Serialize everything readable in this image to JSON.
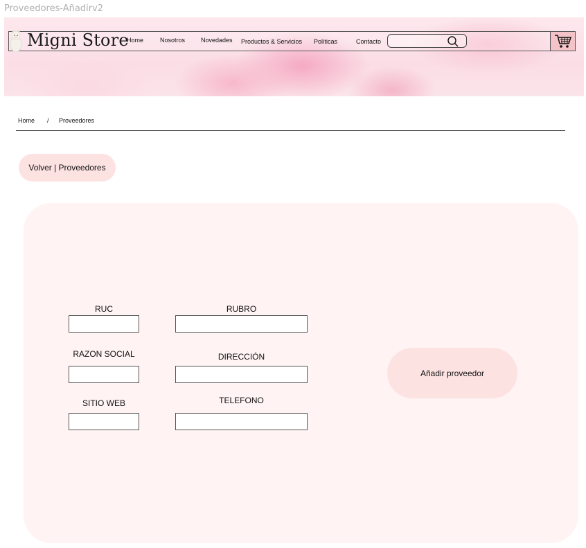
{
  "frame": {
    "title": "Proveedores-Añadirv2"
  },
  "header": {
    "brand": "Migni Store",
    "nav": [
      "Home",
      "Nosotros",
      "Novedades",
      "Productos & Servicios",
      "Políticas",
      "Contacto"
    ],
    "search": {
      "value": "",
      "placeholder": "",
      "icon": "search-icon"
    },
    "cart_icon": "cart-icon",
    "logo_icon": "alpaca-logo"
  },
  "breadcrumb": {
    "home": "Home",
    "separator": "/",
    "current": "Proveedores"
  },
  "back_button": {
    "label": "Volver | Proveedores"
  },
  "form": {
    "fields": {
      "ruc": {
        "label": "RUC",
        "value": ""
      },
      "rubro": {
        "label": "RUBRO",
        "value": ""
      },
      "razon_social": {
        "label": "RAZON SOCIAL",
        "value": ""
      },
      "direccion": {
        "label": "DIRECCIÓN",
        "value": ""
      },
      "sitio_web": {
        "label": "SITIO WEB",
        "value": ""
      },
      "telefono": {
        "label": "TELEFONO",
        "value": ""
      }
    },
    "submit_label": "Añadir proveedor"
  },
  "colors": {
    "panel_bg": "#fff3f3",
    "button_bg": "#fde2e2",
    "cart_bg": "#f3c3c8",
    "hero_pink": "#f7b8cb"
  }
}
